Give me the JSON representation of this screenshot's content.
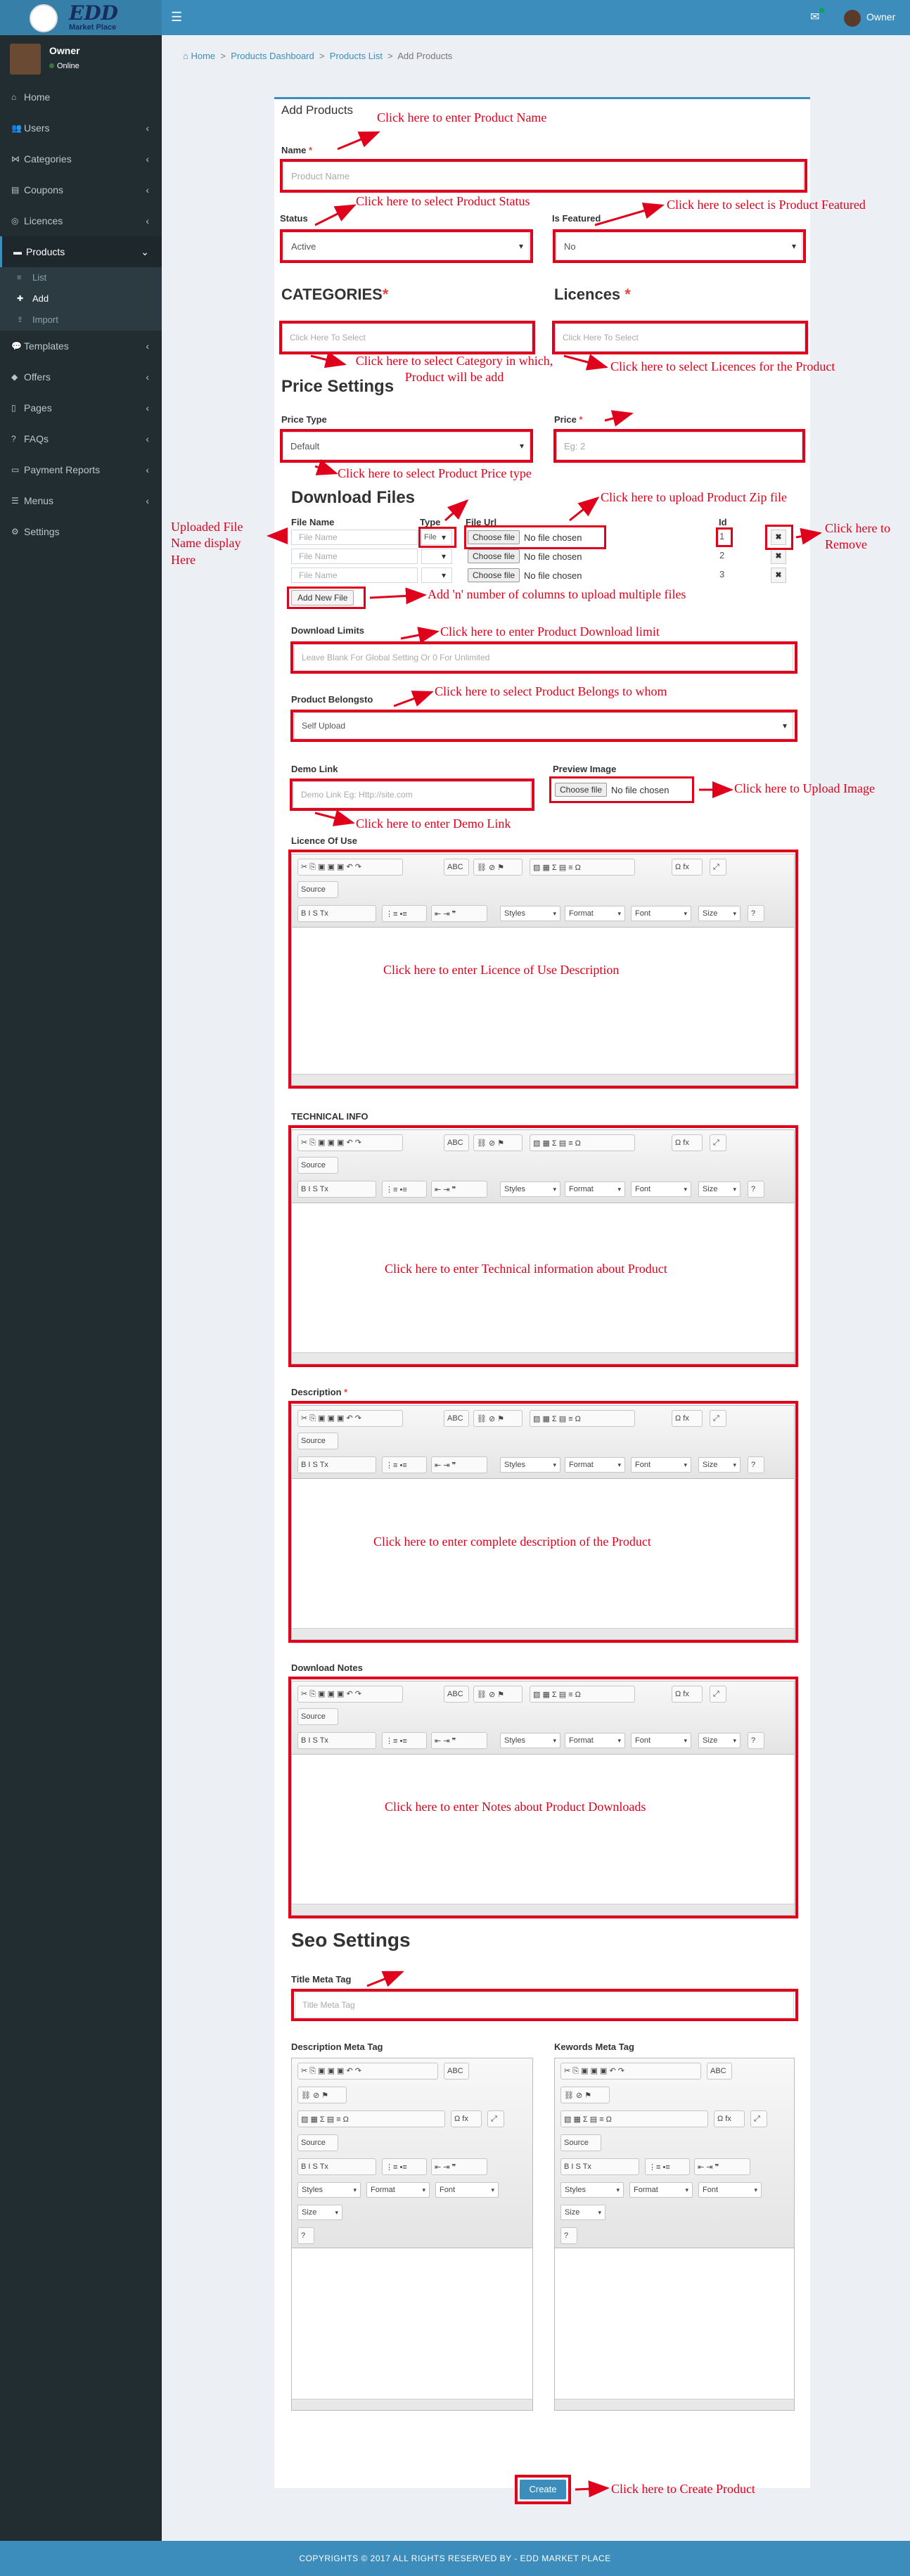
{
  "brand": {
    "logo_text": "EDD",
    "logo_sub": "Market Place"
  },
  "header": {
    "owner_label": "Owner"
  },
  "user_panel": {
    "name": "Owner",
    "status": "Online"
  },
  "sidebar": {
    "items": [
      {
        "label": "Home",
        "icon": "home-icon"
      },
      {
        "label": "Users",
        "icon": "users-icon"
      },
      {
        "label": "Categories",
        "icon": "sitemap-icon"
      },
      {
        "label": "Coupons",
        "icon": "ticket-icon"
      },
      {
        "label": "Licences",
        "icon": "licence-icon"
      },
      {
        "label": "Products",
        "icon": "folder-icon"
      },
      {
        "label": "Templates",
        "icon": "comment-icon"
      },
      {
        "label": "Offers",
        "icon": "tag-icon"
      },
      {
        "label": "Pages",
        "icon": "file-icon"
      },
      {
        "label": "FAQs",
        "icon": "question-icon"
      },
      {
        "label": "Payment Reports",
        "icon": "money-icon"
      },
      {
        "label": "Menus",
        "icon": "bars-icon"
      },
      {
        "label": "Settings",
        "icon": "gear-icon"
      }
    ],
    "products_sub": [
      "List",
      "Add",
      "Import"
    ]
  },
  "breadcrumb": {
    "home": "Home",
    "dashboard": "Products Dashboard",
    "list": "Products List",
    "current": "Add Products"
  },
  "form": {
    "title": "Add Products",
    "name_label": "Name",
    "name_placeholder": "Product Name",
    "status_label": "Status",
    "status_value": "Active",
    "featured_label": "Is Featured",
    "featured_value": "No",
    "categories_title": "CATEGORIES",
    "categories_placeholder": "Click Here To Select",
    "licences_title": "Licences",
    "licences_placeholder": "Click Here To Select",
    "price_settings_title": "Price Settings",
    "price_type_label": "Price Type",
    "price_type_value": "Default",
    "price_label": "Price",
    "price_placeholder": "Eg: 2",
    "download_files_title": "Download Files",
    "col_file_name": "File Name",
    "col_type": "Type",
    "col_file_url": "File Url",
    "col_id": "Id",
    "file_rows": [
      {
        "name_placeholder": "File Name",
        "type": "File",
        "choose": "Choose file",
        "chosen": "No file chosen",
        "id": "1"
      },
      {
        "name_placeholder": "File Name",
        "type": "",
        "choose": "Choose file",
        "chosen": "No file chosen",
        "id": "2"
      },
      {
        "name_placeholder": "File Name",
        "type": "",
        "choose": "Choose file",
        "chosen": "No file chosen",
        "id": "3"
      }
    ],
    "add_file": "Add New File",
    "download_limits_label": "Download Limits",
    "download_limits_placeholder": "Leave Blank For Global Setting Or 0 For Unlimited",
    "belongs_label": "Product Belongsto",
    "belongs_value": "Self Upload",
    "demo_label": "Demo Link",
    "demo_placeholder": "Demo Link Eg: Http://site.com",
    "preview_label": "Preview Image",
    "preview_choose": "Choose file",
    "preview_chosen": "No file chosen",
    "licence_use_label": "Licence Of Use",
    "tech_info_label": "TECHNICAL INFO",
    "description_label": "Description",
    "download_notes_label": "Download Notes",
    "seo_title": "Seo Settings",
    "title_meta_label": "Title Meta Tag",
    "title_meta_placeholder": "Title Meta Tag",
    "desc_meta_label": "Description Meta Tag",
    "kw_meta_label": "Kewords Meta Tag",
    "create": "Create"
  },
  "editor": {
    "source": "Source",
    "styles": "Styles",
    "format": "Format",
    "font": "Font",
    "size": "Size",
    "help": "?"
  },
  "notes": {
    "name": "Click here to enter Product Name",
    "status": "Click here to select Product Status",
    "featured": "Click here to select is Product Featured",
    "category": "Click here to select Category in which, Product will be add",
    "licences": "Click here to select Licences for the Product",
    "price_type": "Click here to select Product Price type",
    "zip": "Click here to upload Product Zip file",
    "uploaded": "Uploaded File Name display Here",
    "remove": "Click here to Remove",
    "add_cols": "Add 'n' number of columns to upload multiple files",
    "dl_limit": "Click here to enter Product Download limit",
    "belongs": "Click here to select Product Belongs to whom",
    "image": "Click here to Upload Image",
    "demo": "Click here to enter Demo Link",
    "licence_desc": "Click here to enter Licence of Use Description",
    "tech": "Click here to enter Technical information about Product",
    "desc": "Click here to enter complete description of the Product",
    "dl_notes": "Click here to enter Notes about Product Downloads",
    "create": "Click here to Create Product"
  },
  "footer": {
    "text": "COPYRIGHTS © 2017 ALL RIGHTS RESERVED BY - EDD MARKET PLACE"
  },
  "colors": {
    "primary": "#3c8dbc",
    "sidebar": "#222d32",
    "annotation": "#e0001b"
  }
}
